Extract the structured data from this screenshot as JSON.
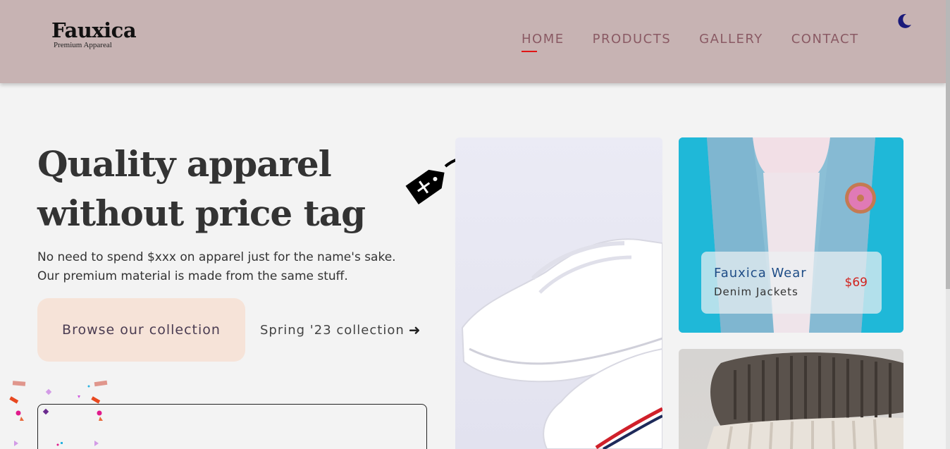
{
  "header": {
    "brand_name": "Fauxica",
    "brand_tagline": "Premium Appareal",
    "nav": [
      {
        "label": "HOME",
        "active": true
      },
      {
        "label": "PRODUCTS",
        "active": false
      },
      {
        "label": "GALLERY",
        "active": false
      },
      {
        "label": "CONTACT",
        "active": false
      }
    ],
    "theme_toggle_icon": "moon-icon"
  },
  "hero": {
    "title_line1": "Quality apparel",
    "title_line2": "without price tag",
    "description_line1": "No need to spend $xxx on apparel just for the name's sake.",
    "description_line2": "Our premium material is made from the same stuff.",
    "primary_button": "Browse our collection",
    "secondary_link": "Spring '23 collection",
    "secondary_link_icon": "arrow-right-icon"
  },
  "featured_card": {
    "title": "Fauxica Wear",
    "subtitle": "Denim Jackets",
    "price": "$69"
  },
  "colors": {
    "header_bg": "#c7b3b3",
    "nav_text": "#8a5a64",
    "active_underline": "#e01515",
    "button_bg": "#f6e3d8",
    "price": "#d0231e",
    "card_title": "#1e4c86"
  }
}
